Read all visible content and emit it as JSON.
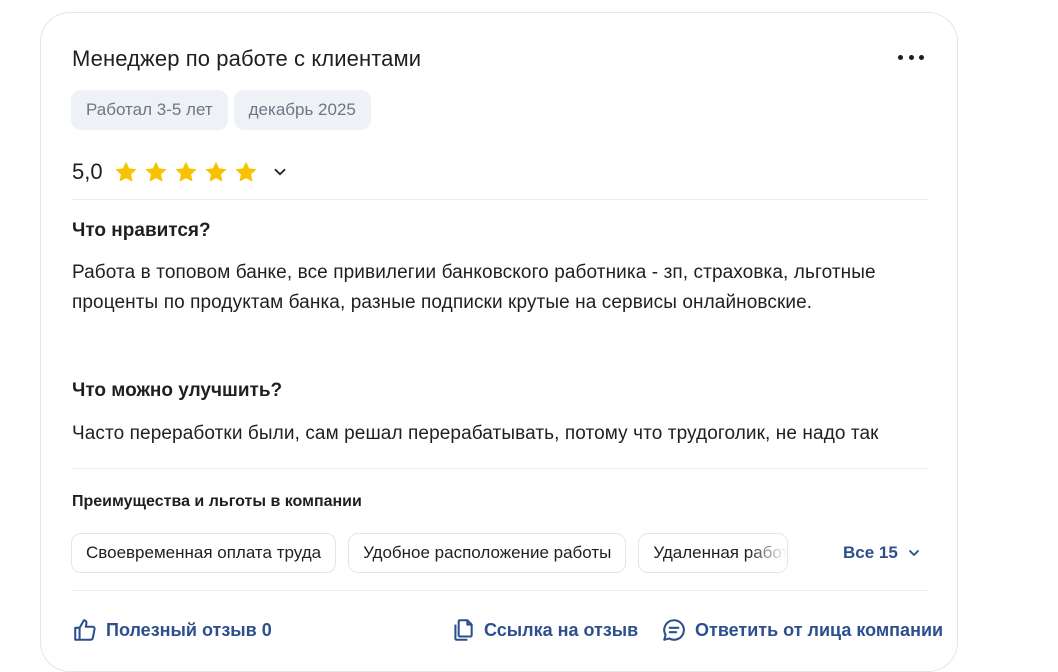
{
  "review": {
    "position": "Менеджер по работе с клиентами",
    "tags": [
      "Работал 3-5 лет",
      "декабрь 2025"
    ],
    "rating": "5,0",
    "stars": 5,
    "likes_title": "Что нравится?",
    "likes_text": "Работа в топовом банке, все привилегии банковского работника - зп, страховка, льготные проценты по продуктам банка, разные подписки крутые на сервисы онлайновские.",
    "improve_title": "Что можно улучшить?",
    "improve_text": "Часто переработки были, сам решал перерабатывать, потому что трудоголик, не надо так"
  },
  "benefits": {
    "title": "Преимущества и льготы в компании",
    "items": [
      "Своевременная оплата труда",
      "Удобное расположение работы",
      "Удаленная работа"
    ],
    "all_label": "Все 15"
  },
  "actions": {
    "helpful": "Полезный отзыв 0",
    "link": "Ссылка на отзыв",
    "reply": "Ответить от лица компании"
  },
  "colors": {
    "accent": "#2d4f8e",
    "star": "#f7c300",
    "tag_bg": "#eef1f5"
  }
}
